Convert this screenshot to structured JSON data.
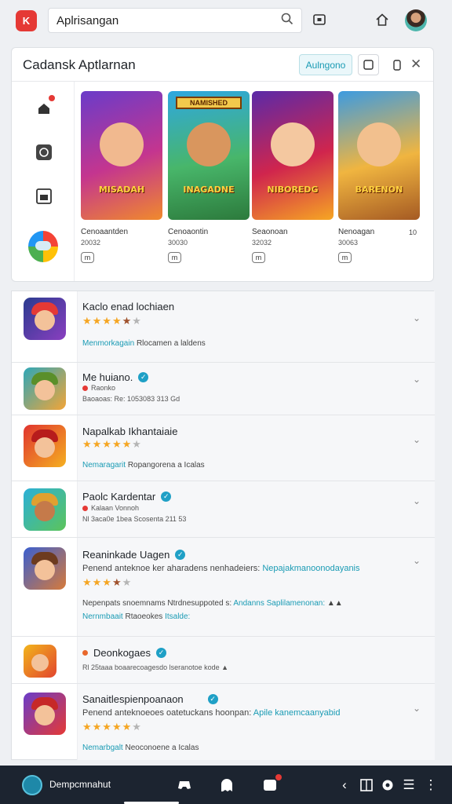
{
  "topbar": {
    "logo_text": "K",
    "search_value": "Aplrisangan",
    "search_icon": "search-icon",
    "icons": [
      "screen-icon",
      "home-icon"
    ]
  },
  "card": {
    "title": "Cadansk Aptlarnan",
    "primary_button": "Aulngono",
    "icon_buttons": [
      "square-icon",
      "phone-icon",
      "close-icon"
    ],
    "games": [
      {
        "banner": "MISADAH",
        "name": "Cenoaantden",
        "count": "20032",
        "mini": "m"
      },
      {
        "banner": "INAGADNE",
        "top_banner": "NAMISHED",
        "name": "Cenoaontin",
        "count": "30030",
        "mini": "m"
      },
      {
        "banner": "NIBOREDG",
        "name": "Seaonoan",
        "count": "32032",
        "mini": "m"
      },
      {
        "banner": "BARENON",
        "name": "Nenoagan",
        "count": "30063",
        "mini": "m",
        "extra": "10"
      }
    ]
  },
  "list": [
    {
      "title": "Kaclo enad lochiaen",
      "rating": 4.5,
      "link": "Menmorkagain",
      "text": "Rlocamen a laldens"
    },
    {
      "title": "Me huiano.",
      "verified": true,
      "meta1": "Raonko",
      "meta2": "Baoaoas: Re: 1053083 313 Gd"
    },
    {
      "title": "Napalkab Ikhantaiaie",
      "rating": 4.5,
      "link": "Nemaragarit",
      "text": "Ropangorena a Icalas"
    },
    {
      "title": "Paolc Kardentar",
      "verified": true,
      "meta1": "Kalaan Vonnoh",
      "meta2": "Nl 3aca0e 1bea Scosenta 211 53"
    },
    {
      "title": "Reaninkade Uagen",
      "verified": true,
      "desc": "Penend anteknoe ker aharadens nenhadeiers:",
      "desc_link": "Nepajakmanoonodayanis",
      "rating": 3.5,
      "line2_text": "Nepenpats snoemnams Ntrdnesuppoted s:",
      "line2_link1": "Andanns",
      "line2_link2": "Saplilamenonan:",
      "link": "Nernmbaait",
      "text": "Rtaoeokes",
      "text_link": "Itsalde:"
    },
    {
      "title": "Deonkogaes",
      "verified": true,
      "meta2": "Rl 25taaa boaarecoagesdo lseranotoe kode"
    },
    {
      "title": "Sanaitlespienpoanaon",
      "verified": true,
      "desc": "Penend anteknoeoes oatetuckans hoonpan:",
      "desc_link": "Apile kanemcaanyabid",
      "rating": 4.5,
      "link": "Nemarbgalt",
      "text": "Neoconoene a Icalas"
    }
  ],
  "bottombar": {
    "label": "Dempcmnahut",
    "icons": [
      "gamepad-icon",
      "ghost-icon",
      "message-icon",
      "back-icon",
      "grid-icon",
      "record-icon",
      "menu-icon",
      "more-icon"
    ]
  }
}
